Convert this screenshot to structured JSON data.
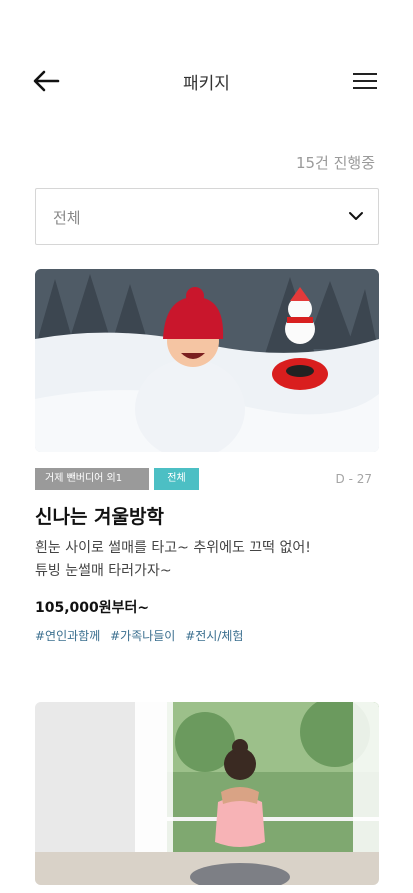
{
  "header": {
    "title": "패키지",
    "back_icon": "arrow-left-icon",
    "menu_icon": "hamburger-menu-icon"
  },
  "count_text": "15건 진행중",
  "filter": {
    "selected": "전체",
    "icon": "chevron-down-icon"
  },
  "cards": [
    {
      "badge_region": "거제 뺀버디어 외1",
      "badge_category": "전체",
      "dday": "D - 27",
      "title": "신나는 겨울방학",
      "desc_line1": "흰눈 사이로 썰매를 타고~ 추위에도 끄떡 없어!",
      "desc_line2": "튜빙 눈썰매 타러가자~",
      "price": "105,000원부터~",
      "tags": [
        "#연인과함께",
        "#가족나들이",
        "#전시/체험"
      ]
    },
    {
      "image": "yoga"
    }
  ],
  "colors": {
    "badge_gray": "#9a9a9a",
    "badge_teal": "#4cbfc4",
    "tag_blue": "#3b6f8f"
  }
}
